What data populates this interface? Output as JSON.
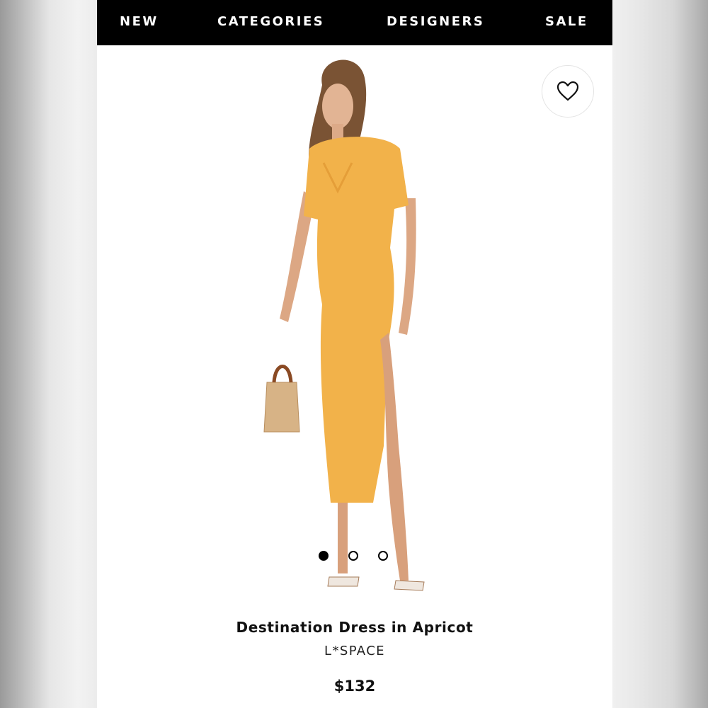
{
  "nav": {
    "items": [
      {
        "label": "NEW"
      },
      {
        "label": "CATEGORIES"
      },
      {
        "label": "DESIGNERS"
      },
      {
        "label": "SALE"
      }
    ]
  },
  "favorite": {
    "icon": "heart-icon"
  },
  "gallery": {
    "dots": [
      {
        "state": "active"
      },
      {
        "state": "inactive"
      },
      {
        "state": "inactive"
      }
    ]
  },
  "product": {
    "name": "Destination Dress in Apricot",
    "brand": "L*SPACE",
    "price": "$132"
  },
  "colors": {
    "nav_bg": "#000000",
    "dress": "#f2b24a",
    "page_bg": "#ffffff"
  }
}
